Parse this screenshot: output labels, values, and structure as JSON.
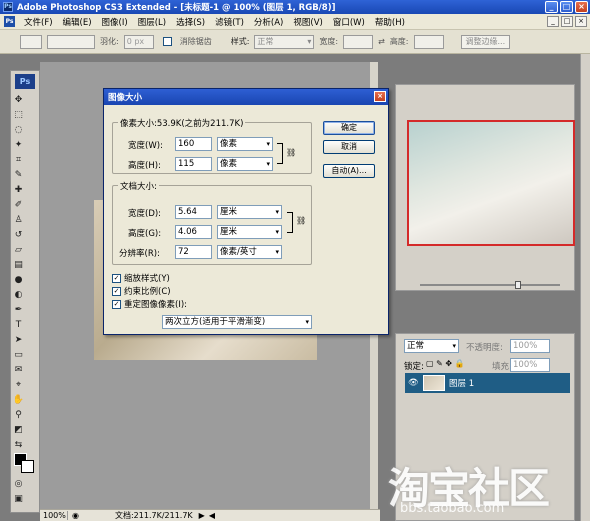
{
  "app": {
    "title": "Adobe Photoshop CS3 Extended - [未标题-1 @ 100% (图层 1, RGB/8)]",
    "ps_logo": "Ps"
  },
  "window_buttons": [
    "_",
    "□",
    "×"
  ],
  "menu": [
    "文件(F)",
    "编辑(E)",
    "图像(I)",
    "图层(L)",
    "选择(S)",
    "滤镜(T)",
    "分析(A)",
    "视图(V)",
    "窗口(W)",
    "帮助(H)"
  ],
  "options_bar": {
    "feather_label": "羽化:",
    "feather_value": "0 px",
    "antialias_label": "消除锯齿",
    "style_label": "样式:",
    "style_value": "正常",
    "width_label": "宽度:",
    "height_label": "高度:",
    "refine_button": "调整边缘..."
  },
  "dialog": {
    "title": "图像大小",
    "pixel_dim_label": "像素大小:53.9K(之前为211.7K)",
    "pixel_width_label": "宽度(W):",
    "pixel_width_value": "160",
    "pixel_width_unit": "像素",
    "pixel_height_label": "高度(H):",
    "pixel_height_value": "115",
    "pixel_height_unit": "像素",
    "doc_size_label": "文档大小:",
    "doc_width_label": "宽度(D):",
    "doc_width_value": "5.64",
    "doc_width_unit": "厘米",
    "doc_height_label": "高度(G):",
    "doc_height_value": "4.06",
    "doc_height_unit": "厘米",
    "resolution_label": "分辨率(R):",
    "resolution_value": "72",
    "resolution_unit": "像素/英寸",
    "scale_styles": "缩放样式(Y)",
    "constrain": "约束比例(C)",
    "resample": "重定图像像素(I):",
    "resample_method": "两次立方(适用于平滑渐变)",
    "ok": "确定",
    "cancel": "取消",
    "auto": "自动(A)..."
  },
  "layers": {
    "blend_mode": "正常",
    "opacity_label": "不透明度:",
    "opacity_value": "100%",
    "lock_label": "锁定:",
    "fill_label": "填充:",
    "fill_value": "100%",
    "layer_name": "图层 1"
  },
  "status": {
    "zoom": "100%",
    "doc_info": "文档:211.7K/211.7K"
  },
  "watermark": {
    "text": "淘宝社区",
    "url": "bbs.taobao.com"
  }
}
